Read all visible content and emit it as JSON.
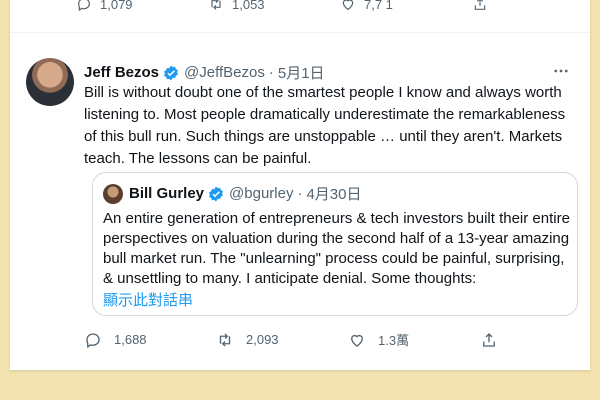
{
  "top_strip": {
    "reply_count": "1,079",
    "retweet_count": "1,053",
    "like_count": "7,7 1"
  },
  "tweet": {
    "author_name": "Jeff Bezos",
    "author_handle": "@JeffBezos",
    "separator": "·",
    "date": "5月1日",
    "text": "Bill is without doubt one of the smartest people I know and always worth listening to. Most people dramatically underestimate the remarkableness of this bull run. Such things are unstoppable … until they aren't.  Markets teach. The lessons can be painful.",
    "quoted": {
      "author_name": "Bill Gurley",
      "author_handle": "@bgurley",
      "separator": "·",
      "date": "4月30日",
      "text": "An entire generation of entrepreneurs & tech investors built their entire perspectives on valuation during the second  half of a 13-year amazing bull market run. The \"unlearning\" process could be painful, surprising, & unsettling to many. I anticipate denial. Some thoughts:",
      "thread_link": "顯示此對話串"
    },
    "actions": {
      "replies": "1,688",
      "retweets": "2,093",
      "likes": "1.3萬"
    }
  },
  "colors": {
    "page_bg": "#f3e3b0",
    "verified_blue": "#1d9bf0",
    "muted_text": "#536471",
    "link_blue": "#1d9bf0"
  },
  "icons": {
    "reply": "reply-icon",
    "retweet": "retweet-icon",
    "like": "heart-icon",
    "share": "share-icon",
    "more": "more-icon",
    "verified": "verified-badge-icon"
  }
}
